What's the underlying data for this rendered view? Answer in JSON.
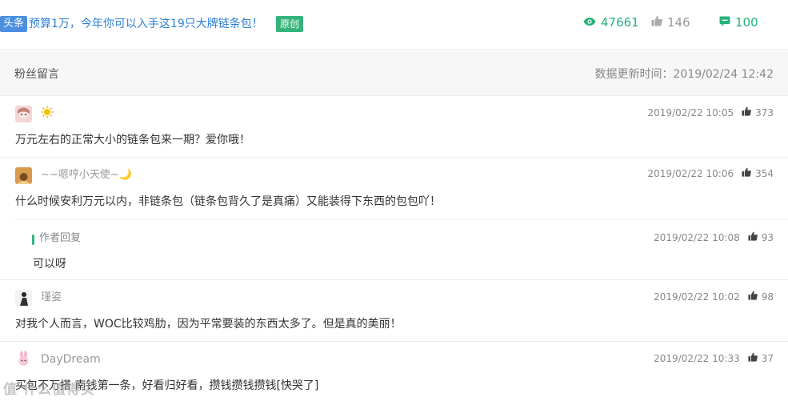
{
  "article": {
    "tag": "头条",
    "title": "预算1万，今年你可以入手这19只大牌链条包！",
    "original_tag": "原创",
    "views": "47661",
    "likes": "146",
    "comments": "100"
  },
  "section": {
    "title": "粉丝留言",
    "update_time": "数据更新时间：2019/02/24 12:42"
  },
  "comments": [
    {
      "nickname": "",
      "time": "2019/02/22 10:05",
      "likes": "373",
      "text": "万元左右的正常大小的链条包来一期？爱你哦！"
    },
    {
      "nickname": "~~嗯哼小天使~🌙",
      "time": "2019/02/22 10:06",
      "likes": "354",
      "text": "什么时候安利万元以内，非链条包（链条包背久了是真痛）又能装得下东西的包包吖！",
      "reply": {
        "label": "作者回复",
        "time": "2019/02/22 10:08",
        "likes": "93",
        "text": "可以呀"
      }
    },
    {
      "nickname": "瑾姿",
      "time": "2019/02/22 10:02",
      "likes": "98",
      "text": "对我个人而言，WOC比较鸡肋，因为平常要装的东西太多了。但是真的美丽！"
    },
    {
      "nickname": "DayDream",
      "time": "2019/02/22 10:33",
      "likes": "37",
      "text": "买包不万搭 南钱第一条，好看归好看，攒钱攒钱攒钱[快哭了]"
    }
  ],
  "watermark": "值 什么值得买",
  "colors": {
    "accent_green": "#25b27a",
    "link_blue": "#2d7fd3",
    "tag_blue": "#4b8fe0"
  }
}
